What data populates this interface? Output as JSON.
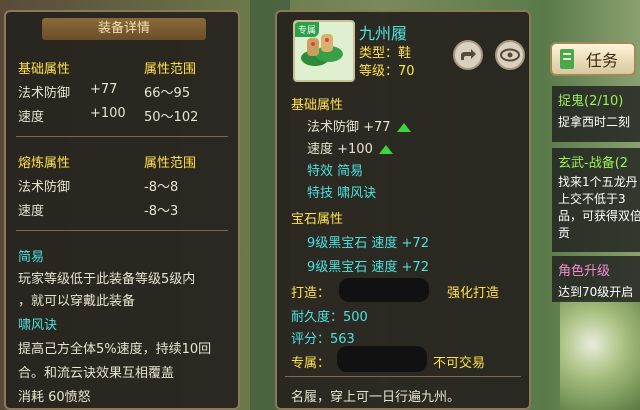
{
  "left": {
    "title": "装备详情",
    "base_header": "基础属性",
    "range_header": "属性范围",
    "base_rows": [
      {
        "name": "法术防御",
        "value": "+77",
        "range": "66～95"
      },
      {
        "name": "速度",
        "value": "+100",
        "range": "50～102"
      }
    ],
    "refine_header": "熔炼属性",
    "refine_range_header": "属性范围",
    "refine_rows": [
      {
        "name": "法术防御",
        "range": "-8～8"
      },
      {
        "name": "速度",
        "range": "-8～3"
      }
    ],
    "skill1_name": "简易",
    "skill1_desc1": "玩家等级低于此装备等级5级内",
    "skill1_desc2": "，就可以穿戴此装备",
    "skill2_name": "啸风诀",
    "skill2_desc1": "提高己方全体5%速度，持续10回",
    "skill2_desc2": "合。和流云诀效果互相覆盖",
    "skill2_cost": "消耗 60愤怒"
  },
  "right": {
    "badge": "专属",
    "item_name": "九州履",
    "type_line": "类型：鞋",
    "level_line": "等级：70",
    "base_header": "基础属性",
    "stat1": "法术防御 +77",
    "stat2": "速度 +100",
    "effect_line": "特效  简易",
    "skill_line": "特技  啸风诀",
    "gem_header": "宝石属性",
    "gem1": "9级黑宝石  速度 +72",
    "gem2": "9级黑宝石  速度 +72",
    "maker_label": "打造：",
    "forge_label": "强化打造",
    "durability": "耐久度：500",
    "score": "评分：563",
    "exclusive_label": "专属：",
    "no_trade": "不可交易",
    "flavor": "名履，穿上可一日行遍九州。"
  },
  "task": {
    "button": "任务",
    "t1_title": "捉鬼(2/10)",
    "t1_desc": "捉拿西时二刻",
    "t2_title": "玄武-战备(2",
    "t2_desc1": "找来1个五龙丹",
    "t2_desc2": "上交不低于3",
    "t2_desc3": "品，可获得双倍",
    "t2_desc4": "贡",
    "t3_title": "角色升级",
    "t3_desc": "达到70级开启"
  },
  "colors": {
    "yellow": "#ffe14a",
    "cyan": "#4fe0e0",
    "green": "#3ed43e",
    "panel": "#26221e"
  }
}
